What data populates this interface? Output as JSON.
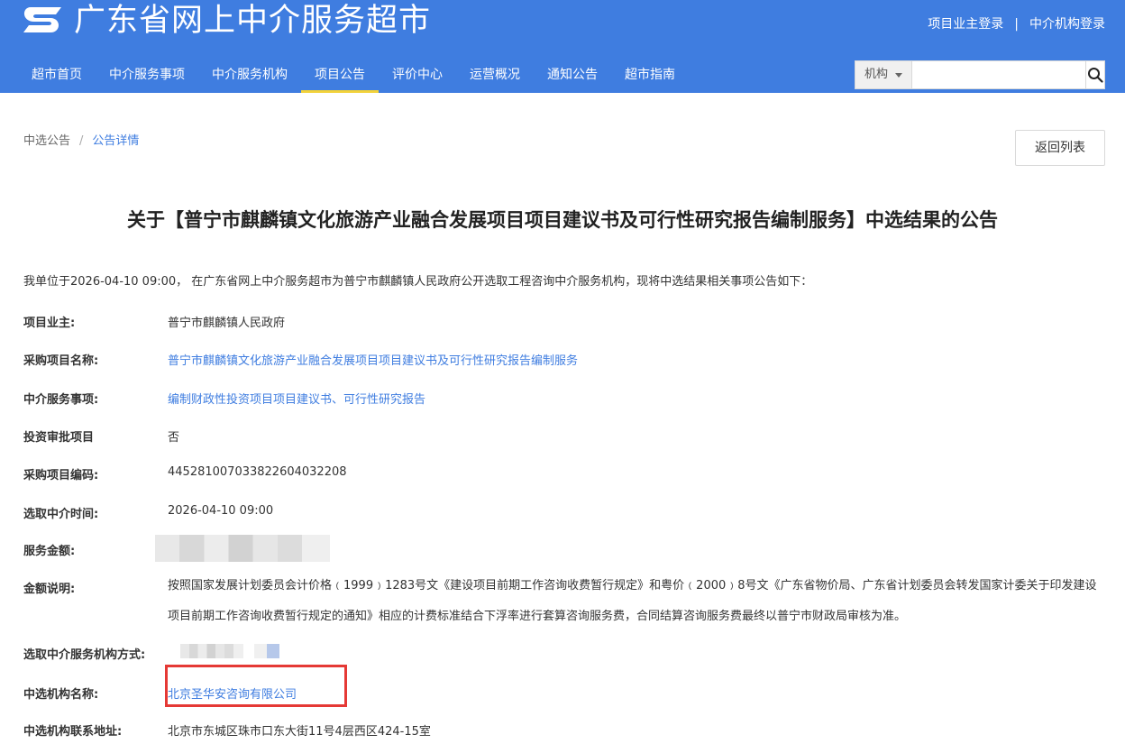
{
  "header": {
    "site_title": "广东省网上中介服务超市",
    "owner_login": "项目业主登录",
    "separator": "|",
    "agency_login": "中介机构登录"
  },
  "nav": {
    "items": [
      "超市首页",
      "中介服务事项",
      "中介服务机构",
      "项目公告",
      "评价中心",
      "运营概况",
      "通知公告",
      "超市指南"
    ],
    "active_index": 3
  },
  "search": {
    "select_value": "机构",
    "input_value": "",
    "placeholder": ""
  },
  "breadcrumb": {
    "parent": "中选公告",
    "separator": "/",
    "current": "公告详情"
  },
  "back_button": "返回列表",
  "announcement": {
    "title": "关于【普宁市麒麟镇文化旅游产业融合发展项目项目建议书及可行性研究报告编制服务】中选结果的公告",
    "intro": "我单位于2026-04-10 09:00， 在广东省网上中介服务超市为普宁市麒麟镇人民政府公开选取工程咨询中介服务机构，现将中选结果相关事项公告如下：",
    "fields": {
      "owner": {
        "label": "项目业主:",
        "value": "普宁市麒麟镇人民政府"
      },
      "project_name": {
        "label": "采购项目名称:",
        "value": "普宁市麒麟镇文化旅游产业融合发展项目项目建议书及可行性研究报告编制服务"
      },
      "service_item": {
        "label": "中介服务事项:",
        "value": "编制财政性投资项目项目建议书、可行性研究报告"
      },
      "investment_approval": {
        "label": "投资审批项目",
        "value": "否"
      },
      "project_code": {
        "label": "采购项目编码:",
        "value": "445281007033822604032208"
      },
      "selection_time": {
        "label": "选取中介时间:",
        "value": "2026-04-10 09:00"
      },
      "service_amount": {
        "label": "服务金额:",
        "value": ""
      },
      "amount_note": {
        "label": "金额说明:",
        "value": "按照国家发展计划委员会计价格﹙1999﹚1283号文《建设项目前期工作咨询收费暂行规定》和粤价﹙2000﹚8号文《广东省物价局、广东省计划委员会转发国家计委关于印发建设项目前期工作咨询收费暂行规定的通知》相应的计费标准结合下浮率进行套算咨询服务费，合同结算咨询服务费最终以普宁市财政局审核为准。"
      },
      "selection_method": {
        "label": "选取中介服务机构方式:",
        "value": ""
      },
      "winner_name": {
        "label": "中选机构名称:",
        "value": "北京圣华安咨询有限公司"
      },
      "winner_address": {
        "label": "中选机构联系地址:",
        "value": "北京市东城区珠市口东大街11号4层西区424-15室"
      }
    }
  },
  "colors": {
    "header_bg": "#3f7de0",
    "active_underline": "#f2d23a",
    "link": "#3f7de0",
    "highlight_border": "#e53935"
  },
  "icons": {
    "logo": "site-logo",
    "search": "search-icon",
    "dropdown": "caret-down-icon"
  }
}
